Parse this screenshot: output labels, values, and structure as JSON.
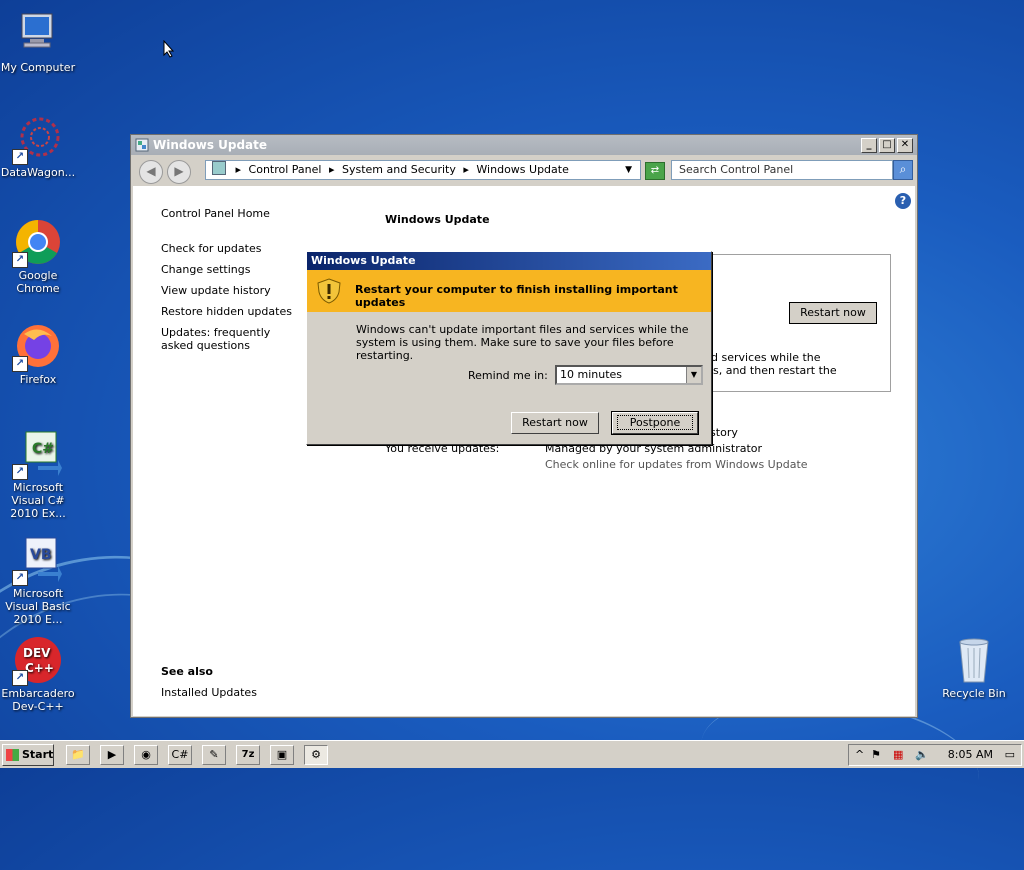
{
  "desktop": {
    "icons": [
      {
        "label": "My Computer",
        "icon": "computer-icon"
      },
      {
        "label": "DataWagon...",
        "icon": "datawagon-icon"
      },
      {
        "label": "Google Chrome",
        "icon": "chrome-icon"
      },
      {
        "label": "Firefox",
        "icon": "firefox-icon"
      },
      {
        "label": "Microsoft Visual C# 2010 Ex...",
        "icon": "visual-csharp-icon"
      },
      {
        "label": "Microsoft Visual Basic 2010 E...",
        "icon": "visual-basic-icon"
      },
      {
        "label": "Embarcadero Dev-C++",
        "icon": "devcpp-icon"
      },
      {
        "label": "Recycle Bin",
        "icon": "recycle-bin-icon"
      }
    ]
  },
  "window": {
    "title": "Windows Update",
    "breadcrumb": [
      "Control Panel",
      "System and Security",
      "Windows Update"
    ],
    "search_placeholder": "Search Control Panel",
    "sidebar": {
      "home": "Control Panel Home",
      "links": [
        "Check for updates",
        "Change settings",
        "View update history",
        "Restore hidden updates",
        "Updates: frequently asked questions"
      ],
      "see_also_title": "See also",
      "see_also_links": [
        "Installed Updates"
      ]
    },
    "main": {
      "heading": "Windows Update",
      "restart_button": "Restart now",
      "partial_text_1": "d services while the",
      "partial_text_2": "s, and then restart the",
      "partial_history": "istory",
      "receive_label": "You receive updates:",
      "receive_value": "Managed by your system administrator",
      "check_online": "Check online for updates from Windows Update"
    }
  },
  "dialog": {
    "title": "Windows Update",
    "banner": "Restart your computer to finish installing important updates",
    "body": "Windows can't update important files and services while the system is using them. Make sure to save your files before restarting.",
    "remind_label": "Remind me in:",
    "remind_value": "10 minutes",
    "restart_button": "Restart now",
    "postpone_button": "Postpone"
  },
  "taskbar": {
    "start_label": "Start",
    "clock": "8:05 AM",
    "pinned": [
      "explorer-icon",
      "media-player-icon",
      "chrome-icon",
      "visual-csharp-icon",
      "notepad-icon",
      "7zip-icon",
      "remote-desktop-icon",
      "windows-update-icon"
    ],
    "zip_label": "7z"
  },
  "colors": {
    "desktop": "#1a5cbf",
    "banner": "#f7b521",
    "dialog_title": "#0a246a"
  }
}
